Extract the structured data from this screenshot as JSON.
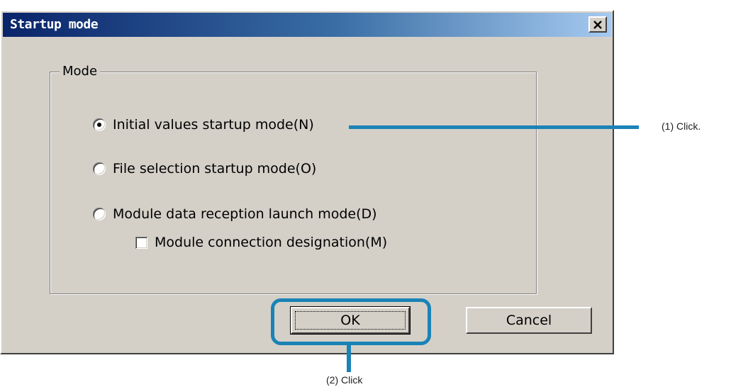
{
  "dialog": {
    "title": "Startup mode",
    "close_label": "×",
    "group_label": "Mode",
    "options": [
      {
        "label": "Initial values startup mode(N)",
        "checked": true
      },
      {
        "label": "File selection startup mode(O)",
        "checked": false
      },
      {
        "label": "Module data reception launch mode(D)",
        "checked": false
      }
    ],
    "sub_option": {
      "label": "Module connection designation(M)",
      "checked": false
    },
    "ok_label": "OK",
    "cancel_label": "Cancel"
  },
  "annotations": {
    "step1": "(1) Click.",
    "step2": "(2) Click"
  },
  "colors": {
    "highlight": "#1a83b6",
    "dialog_bg": "#d4d0c8",
    "title_start": "#0a246a"
  }
}
